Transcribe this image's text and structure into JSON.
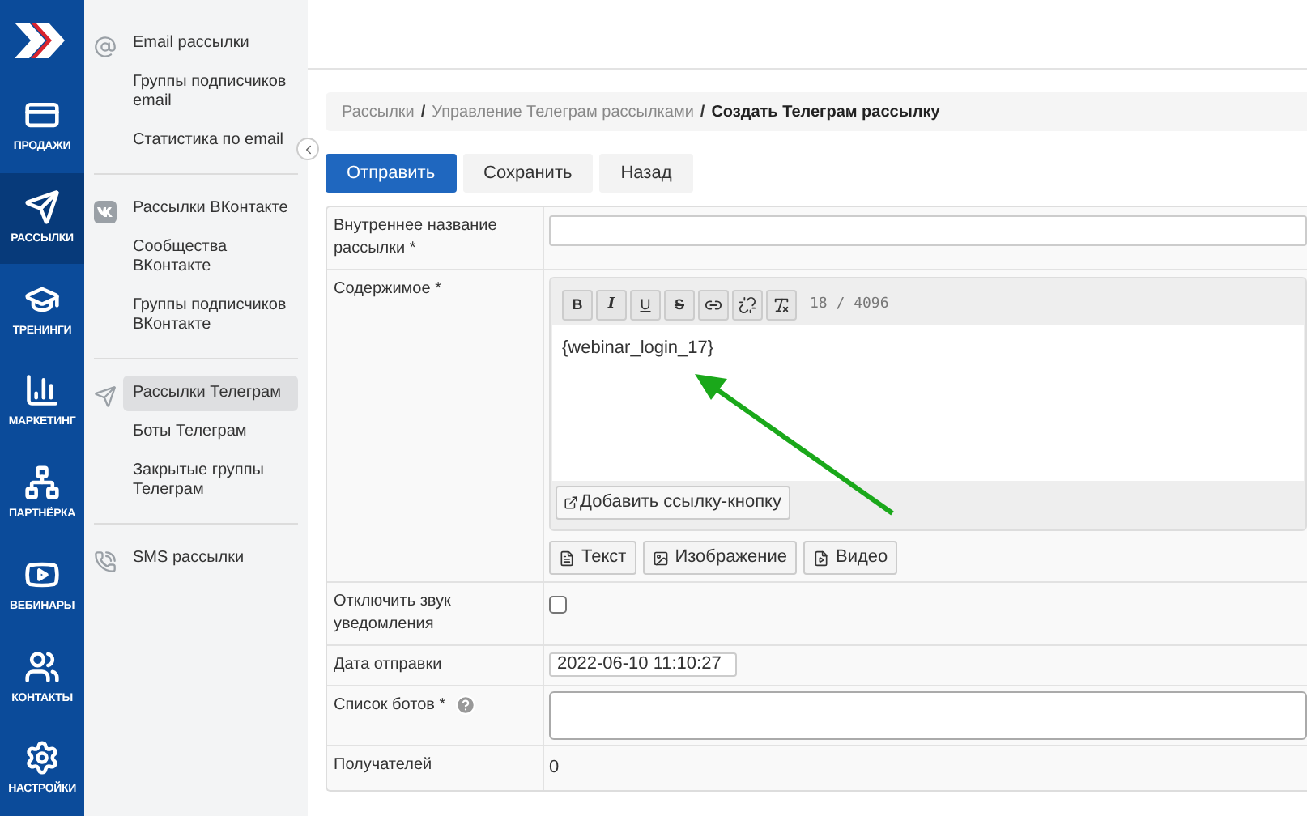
{
  "rail": [
    {
      "kind": "sales",
      "label": "ПРОДАЖИ",
      "selected": false
    },
    {
      "kind": "mail",
      "label": "РАССЫЛКИ",
      "selected": true
    },
    {
      "kind": "training",
      "label": "ТРЕНИНГИ",
      "selected": false
    },
    {
      "kind": "marketing",
      "label": "МАРКЕТИНГ",
      "selected": false
    },
    {
      "kind": "partner",
      "label": "ПАРТНЁРКА",
      "selected": false
    },
    {
      "kind": "webinar",
      "label": "ВЕБИНАРЫ",
      "selected": false
    },
    {
      "kind": "contacts",
      "label": "КОНТАКТЫ",
      "selected": false
    },
    {
      "kind": "settings",
      "label": "НАСТРОЙКИ",
      "selected": false
    }
  ],
  "submenu": [
    {
      "kind": "email",
      "items": [
        {
          "label": "Email рассылки",
          "selected": false
        },
        {
          "label": "Группы подписчиков email",
          "selected": false
        },
        {
          "label": "Статистика по email",
          "selected": false
        }
      ]
    },
    {
      "kind": "vk",
      "items": [
        {
          "label": "Рассылки ВКонтакте",
          "selected": false
        },
        {
          "label": "Сообщества ВКонтакте",
          "selected": false
        },
        {
          "label": "Группы подписчиков ВКонтакте",
          "selected": false
        }
      ]
    },
    {
      "kind": "telegram",
      "items": [
        {
          "label": "Рассылки Телеграм",
          "selected": true
        },
        {
          "label": "Боты Телеграм",
          "selected": false
        },
        {
          "label": "Закрытые группы Телеграм",
          "selected": false
        }
      ]
    },
    {
      "kind": "sms",
      "items": [
        {
          "label": "SMS рассылки",
          "selected": false
        }
      ]
    }
  ],
  "breadcrumb": {
    "separator": "/",
    "items": [
      "Рассылки",
      "Управление Телеграм рассылками",
      "Создать Телеграм рассылку"
    ]
  },
  "buttons": [
    {
      "label": "Отправить",
      "primary": true
    },
    {
      "label": "Сохранить",
      "primary": false
    },
    {
      "label": "Назад",
      "primary": false
    }
  ],
  "form": [
    {
      "kind": "input",
      "label": "Внутреннее название рассылки *"
    },
    {
      "kind": "editor",
      "label": "Содержимое *",
      "toolbar": [
        {
          "kind": "bold",
          "label": "B"
        },
        {
          "kind": "italic",
          "label": "I"
        },
        {
          "kind": "underline",
          "label": "U"
        },
        {
          "kind": "strike",
          "label": "S"
        },
        {
          "kind": "link"
        },
        {
          "kind": "unlink"
        },
        {
          "kind": "clear"
        }
      ],
      "counter": "18 / 4096",
      "value": "{webinar_login_17}",
      "add_button": "Добавить ссылку-кнопку",
      "types": [
        {
          "kind": "text",
          "label": "Текст"
        },
        {
          "kind": "image",
          "label": "Изображение"
        },
        {
          "kind": "video",
          "label": "Видео"
        }
      ]
    },
    {
      "kind": "checkbox",
      "label": "Отключить звук уведомления",
      "checked": false
    },
    {
      "kind": "date",
      "label": "Дата отправки",
      "value": "2022-06-10 11:10:27"
    },
    {
      "kind": "select",
      "label": "Список ботов *",
      "help": true
    },
    {
      "kind": "static",
      "label": "Получателей",
      "value": "0"
    }
  ]
}
